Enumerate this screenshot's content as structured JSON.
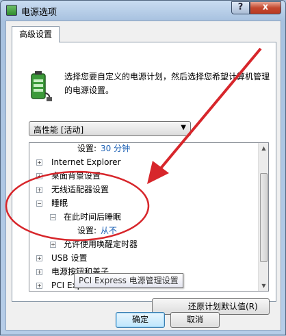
{
  "window": {
    "title": "电源选项",
    "help_glyph": "?",
    "close_glyph": "x"
  },
  "tab": {
    "label": "高级设置"
  },
  "description": "选择您要自定义的电源计划，然后选择您希望计算机管理的电源设置。",
  "plan_select": {
    "value": "高性能 [活动]",
    "arrow": "▼"
  },
  "tree": {
    "setting_label": "设置:",
    "items": [
      {
        "exp": "",
        "text": "",
        "value": "30 分钟"
      },
      {
        "exp": "+",
        "text": "Internet Explorer"
      },
      {
        "exp": "+",
        "text": "桌面背景设置"
      },
      {
        "exp": "+",
        "text": "无线适配器设置"
      },
      {
        "exp": "−",
        "text": "睡眠"
      },
      {
        "exp": "−",
        "text": "在此时间后睡眠"
      },
      {
        "exp": "",
        "text": "",
        "value": "从不"
      },
      {
        "exp": "+",
        "text": "允许使用唤醒定时器"
      },
      {
        "exp": "+",
        "text": "USB 设置"
      },
      {
        "exp": "+",
        "text": "电源按钮和盖子"
      },
      {
        "exp": "+",
        "text": "PCI Express"
      }
    ]
  },
  "scrollbar": {
    "up": "▲",
    "down": "▼"
  },
  "restore_button": {
    "label": "还原计划默认值(R)"
  },
  "tooltip": {
    "text": "PCI Express 电源管理设置"
  },
  "buttons": {
    "ok": "确定",
    "cancel": "取消"
  },
  "colors": {
    "value_text": "#1a5fb4",
    "annotation": "#d7262b",
    "title_bar": "#a7c1df"
  },
  "icons": {
    "title": "power-options-icon",
    "plan": "battery-plug-icon"
  }
}
